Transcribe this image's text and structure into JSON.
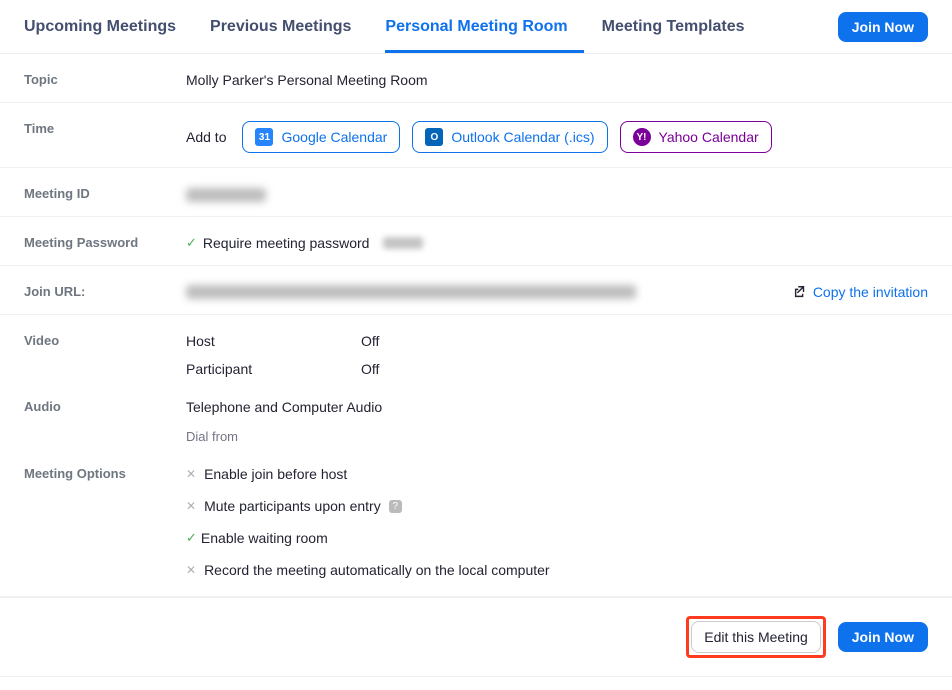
{
  "tabs": {
    "upcoming": "Upcoming Meetings",
    "previous": "Previous Meetings",
    "personal": "Personal Meeting Room",
    "templates": "Meeting Templates"
  },
  "join_now": "Join Now",
  "labels": {
    "topic": "Topic",
    "time": "Time",
    "meeting_id": "Meeting ID",
    "meeting_password": "Meeting Password",
    "join_url": "Join URL:",
    "video": "Video",
    "audio": "Audio",
    "meeting_options": "Meeting Options"
  },
  "topic_value": "Molly Parker's Personal Meeting Room",
  "add_to": "Add to",
  "calendars": {
    "google": "Google Calendar",
    "google_icon": "31",
    "outlook": "Outlook Calendar (.ics)",
    "outlook_icon": "O",
    "yahoo": "Yahoo Calendar",
    "yahoo_icon": "Y!"
  },
  "password": {
    "require": "Require meeting password"
  },
  "copy_invitation": "Copy the invitation",
  "video": {
    "host_label": "Host",
    "host_value": "Off",
    "participant_label": "Participant",
    "participant_value": "Off"
  },
  "audio": {
    "value": "Telephone and Computer Audio",
    "dial_from": "Dial from"
  },
  "options": {
    "join_before": "Enable join before host",
    "mute": "Mute participants upon entry",
    "waiting_room": "Enable waiting room",
    "record": "Record the meeting automatically on the local computer"
  },
  "footer": {
    "edit": "Edit this Meeting",
    "join": "Join Now"
  }
}
